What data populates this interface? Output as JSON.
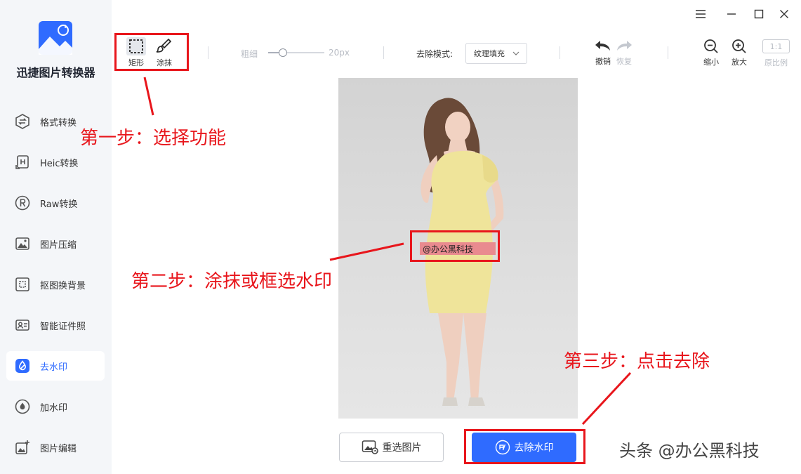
{
  "app": {
    "title": "迅捷图片转换器"
  },
  "sidebar": {
    "items": [
      {
        "label": "格式转换",
        "icon": "format-convert-icon"
      },
      {
        "label": "Heic转换",
        "icon": "heic-icon"
      },
      {
        "label": "Raw转换",
        "icon": "raw-icon"
      },
      {
        "label": "图片压缩",
        "icon": "compress-icon"
      },
      {
        "label": "抠图换背景",
        "icon": "cutout-icon"
      },
      {
        "label": "智能证件照",
        "icon": "id-photo-icon"
      },
      {
        "label": "去水印",
        "icon": "remove-watermark-icon",
        "active": true
      },
      {
        "label": "加水印",
        "icon": "add-watermark-icon"
      },
      {
        "label": "图片编辑",
        "icon": "edit-image-icon"
      }
    ]
  },
  "toolbar": {
    "rect_label": "矩形",
    "brush_label": "涂抹",
    "size_label": "粗细",
    "size_value": "20px",
    "size_level": 0.2,
    "mode_label": "去除模式:",
    "mode_value": "纹理填充",
    "undo_label": "撤销",
    "redo_label": "恢复",
    "zoom_out_label": "缩小",
    "zoom_in_label": "放大",
    "ratio_box": "1:1",
    "ratio_label": "原比例"
  },
  "canvas": {
    "watermark": "@办公黑科技"
  },
  "annotations": {
    "step1": "第一步：选择功能",
    "step2": "第二步：涂抹或框选水印",
    "step3": "第三步：点击去除"
  },
  "buttons": {
    "reselect": "重选图片",
    "remove": "去除水印"
  },
  "footer_watermark": "头条 @办公黑科技",
  "colors": {
    "accent": "#2f6bff",
    "annotation_red": "#e8161c",
    "sidebar_bg": "#f4f6f9"
  }
}
